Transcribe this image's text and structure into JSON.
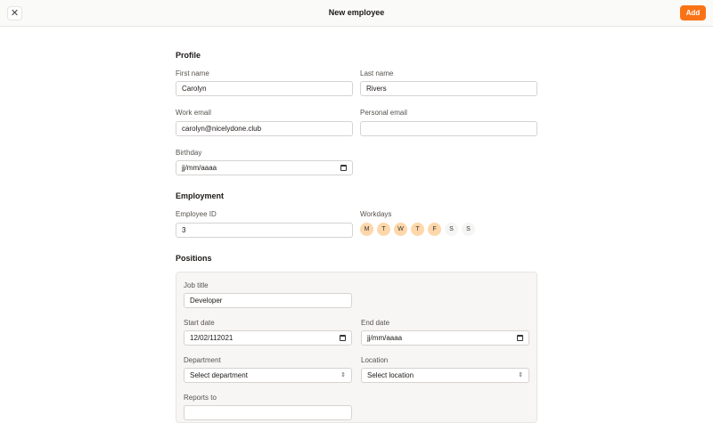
{
  "header": {
    "title": "New employee",
    "add_label": "Add",
    "close_icon": "x-icon"
  },
  "profile": {
    "heading": "Profile",
    "first_name_label": "First name",
    "first_name": "Carolyn",
    "last_name_label": "Last name",
    "last_name": "Rivers",
    "work_email_label": "Work email",
    "work_email": "carolyn@nicelydone.club",
    "personal_email_label": "Personal email",
    "personal_email": "",
    "birthday_label": "Birthday",
    "birthday": "jj/mm/aaaa"
  },
  "employment": {
    "heading": "Employment",
    "employee_id_label": "Employee ID",
    "employee_id": "3",
    "workdays_label": "Workdays",
    "workdays": [
      {
        "label": "M",
        "on": true
      },
      {
        "label": "T",
        "on": true
      },
      {
        "label": "W",
        "on": true
      },
      {
        "label": "T",
        "on": true
      },
      {
        "label": "F",
        "on": true
      },
      {
        "label": "S",
        "on": false
      },
      {
        "label": "S",
        "on": false
      }
    ]
  },
  "positions": {
    "heading": "Positions",
    "job_title_label": "Job title",
    "job_title": "Developer",
    "start_date_label": "Start date",
    "start_date": "12/02/112021",
    "end_date_label": "End date",
    "end_date": "jj/mm/aaaa",
    "department_label": "Department",
    "department": "Select department",
    "location_label": "Location",
    "location": "Select location",
    "reports_to_label": "Reports to"
  },
  "colors": {
    "accent": "#f97316",
    "workday_on": "#fed7aa"
  }
}
